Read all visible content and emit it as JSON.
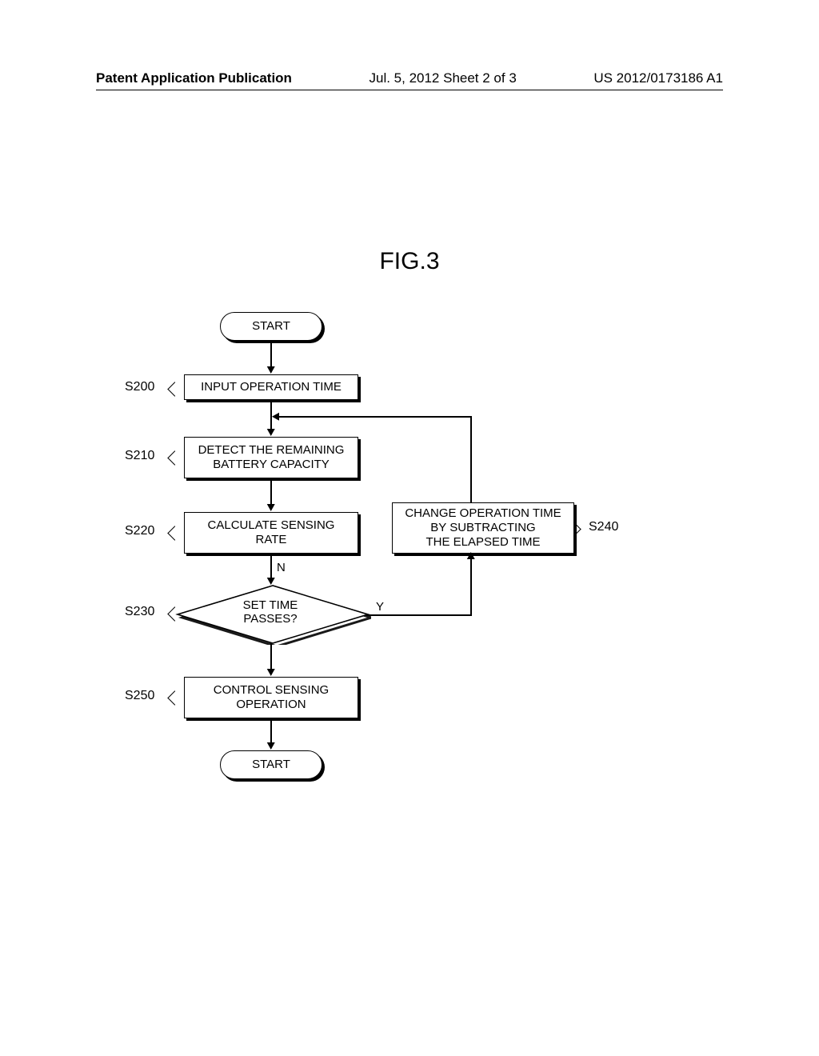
{
  "header": {
    "left": "Patent Application Publication",
    "center": "Jul. 5, 2012   Sheet 2 of 3",
    "right": "US 2012/0173186 A1"
  },
  "figure_title": "FIG.3",
  "terminator_start": "START",
  "terminator_end": "START",
  "steps": {
    "s200": {
      "ref": "S200",
      "text_l1": "INPUT OPERATION TIME"
    },
    "s210": {
      "ref": "S210",
      "text_l1": "DETECT THE REMAINING",
      "text_l2": "BATTERY CAPACITY"
    },
    "s220": {
      "ref": "S220",
      "text_l1": "CALCULATE SENSING",
      "text_l2": "RATE"
    },
    "s230": {
      "ref": "S230",
      "text_l1": "SET TIME",
      "text_l2": "PASSES?"
    },
    "s240": {
      "ref": "S240",
      "text_l1": "CHANGE OPERATION TIME",
      "text_l2": "BY SUBTRACTING",
      "text_l3": "THE ELAPSED TIME"
    },
    "s250": {
      "ref": "S250",
      "text_l1": "CONTROL SENSING",
      "text_l2": "OPERATION"
    }
  },
  "branch": {
    "yes": "Y",
    "no": "N"
  }
}
